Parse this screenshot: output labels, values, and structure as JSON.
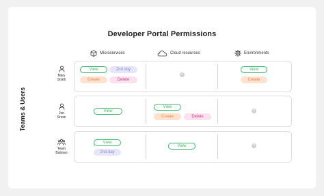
{
  "title": "Developer Portal Permissions",
  "side_label": "Teams & Users",
  "columns": {
    "microservices": {
      "label": "Microservices",
      "icon": "cube-icon"
    },
    "cloud": {
      "label": "Cloud resources",
      "icon": "cloud-icon"
    },
    "environments": {
      "label": "Environments",
      "icon": "gear-icon"
    }
  },
  "rows": [
    {
      "user_line1": "Mary",
      "user_line2": "Smith",
      "icon": "person-icon",
      "microservices": [
        "View",
        "2nd day",
        "Create",
        "Delete"
      ],
      "environments": [
        "View",
        "Create"
      ]
    },
    {
      "user_line1": "Jon",
      "user_line2": "Snow",
      "icon": "person-icon",
      "microservices": [
        "View"
      ],
      "cloud": [
        "View",
        "Create",
        "Delete"
      ]
    },
    {
      "user_line1": "Team",
      "user_line2": "Batman",
      "icon": "team-icon",
      "microservices": [
        "View",
        "2nd day"
      ],
      "cloud": [
        "View"
      ]
    }
  ],
  "colors": {
    "view": "#3bb86a",
    "create": "#e8844a",
    "delete": "#d23f8a",
    "day": "#8a8ad6"
  }
}
